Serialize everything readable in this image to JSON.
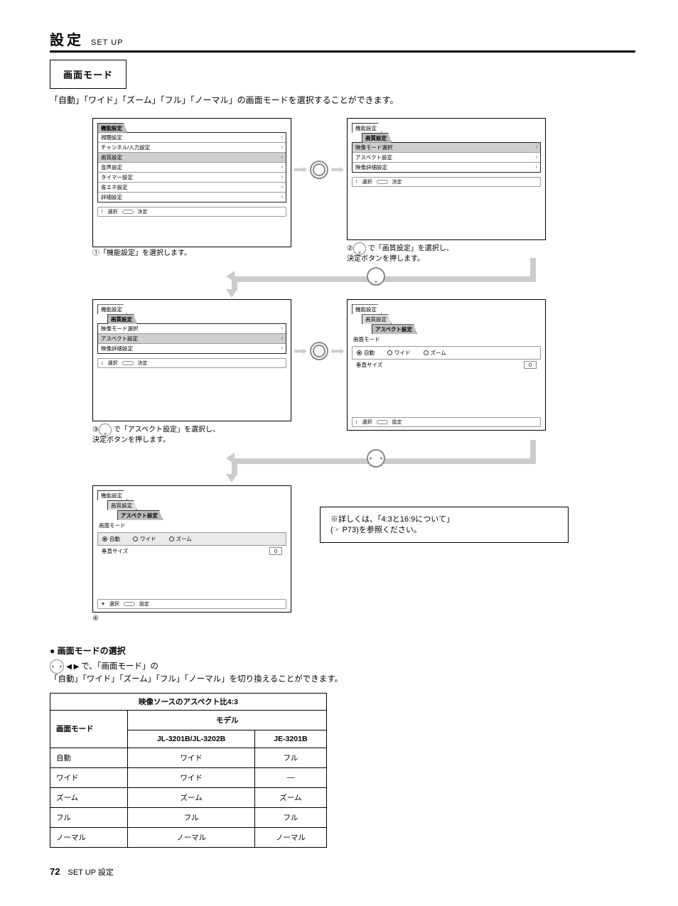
{
  "header": {
    "jp": "設定",
    "en": "SET UP"
  },
  "mode_box": "画面モード",
  "intro": "「自動」「ワイド」「ズーム」「フル」「ノーマル」の画面モードを選択することができます。",
  "steps": {
    "s1": "①「機能設定」を選択します。",
    "s2a": "②",
    "s2b": " で「画質設定」を選択し、",
    "s2c": "決定ボタンを押します。",
    "s3a": "③",
    "s3b": " で「アスペクト設定」を選択し、",
    "s3c": "決定ボタンを押します。",
    "s4": "④"
  },
  "menu_main": {
    "title": "機能設定",
    "items": [
      "視聴設定",
      "チャンネル/入力設定",
      "画質設定",
      "音声設定",
      "タイマー設定",
      "省エネ設定",
      "詳細設定"
    ],
    "hint_select": "選択",
    "hint_enter": "決定"
  },
  "menu_pic": {
    "bc": [
      "機能設定",
      "画質設定"
    ],
    "items": [
      "映像モード選択",
      "アスペクト設定",
      "映像詳細設定"
    ],
    "hint_select": "選択",
    "hint_enter": "決定"
  },
  "menu_aspect": {
    "bc": [
      "機能設定",
      "画質設定",
      "アスペクト設定"
    ],
    "row_label": "画面モード",
    "opts": [
      "自動",
      "ワイド",
      "ズーム"
    ],
    "v_label": "垂直サイズ",
    "v_value": "0",
    "hint_select": "選択",
    "hint_set": "設定"
  },
  "help": {
    "line1": "※詳しくは、「4:3と16:9について」",
    "line2": "(☞ P73)を参照ください。"
  },
  "mode_section": {
    "title": "● 画面モードの選択",
    "body_a": "で、「画面モード」の",
    "body_b": "「自動」「ワイド」「ズーム」「フル」「ノーマル」を切り換えることができます。"
  },
  "table": {
    "caption": "映像ソースのアスペクト比4:3",
    "head_left": "画面モード",
    "head_model": "モデル",
    "cols": [
      "JL-3201B/JL-3202B",
      "JE-3201B"
    ],
    "rows": [
      {
        "mode": "自動",
        "c1": "ワイド",
        "c2": "フル"
      },
      {
        "mode": "ワイド",
        "c1": "ワイド",
        "c2": "—"
      },
      {
        "mode": "ズーム",
        "c1": "ズーム",
        "c2": "ズーム"
      },
      {
        "mode": "フル",
        "c1": "フル",
        "c2": "フル"
      },
      {
        "mode": "ノーマル",
        "c1": "ノーマル",
        "c2": "ノーマル"
      }
    ]
  },
  "footer": {
    "page": "72",
    "label": "SET UP 設定"
  }
}
